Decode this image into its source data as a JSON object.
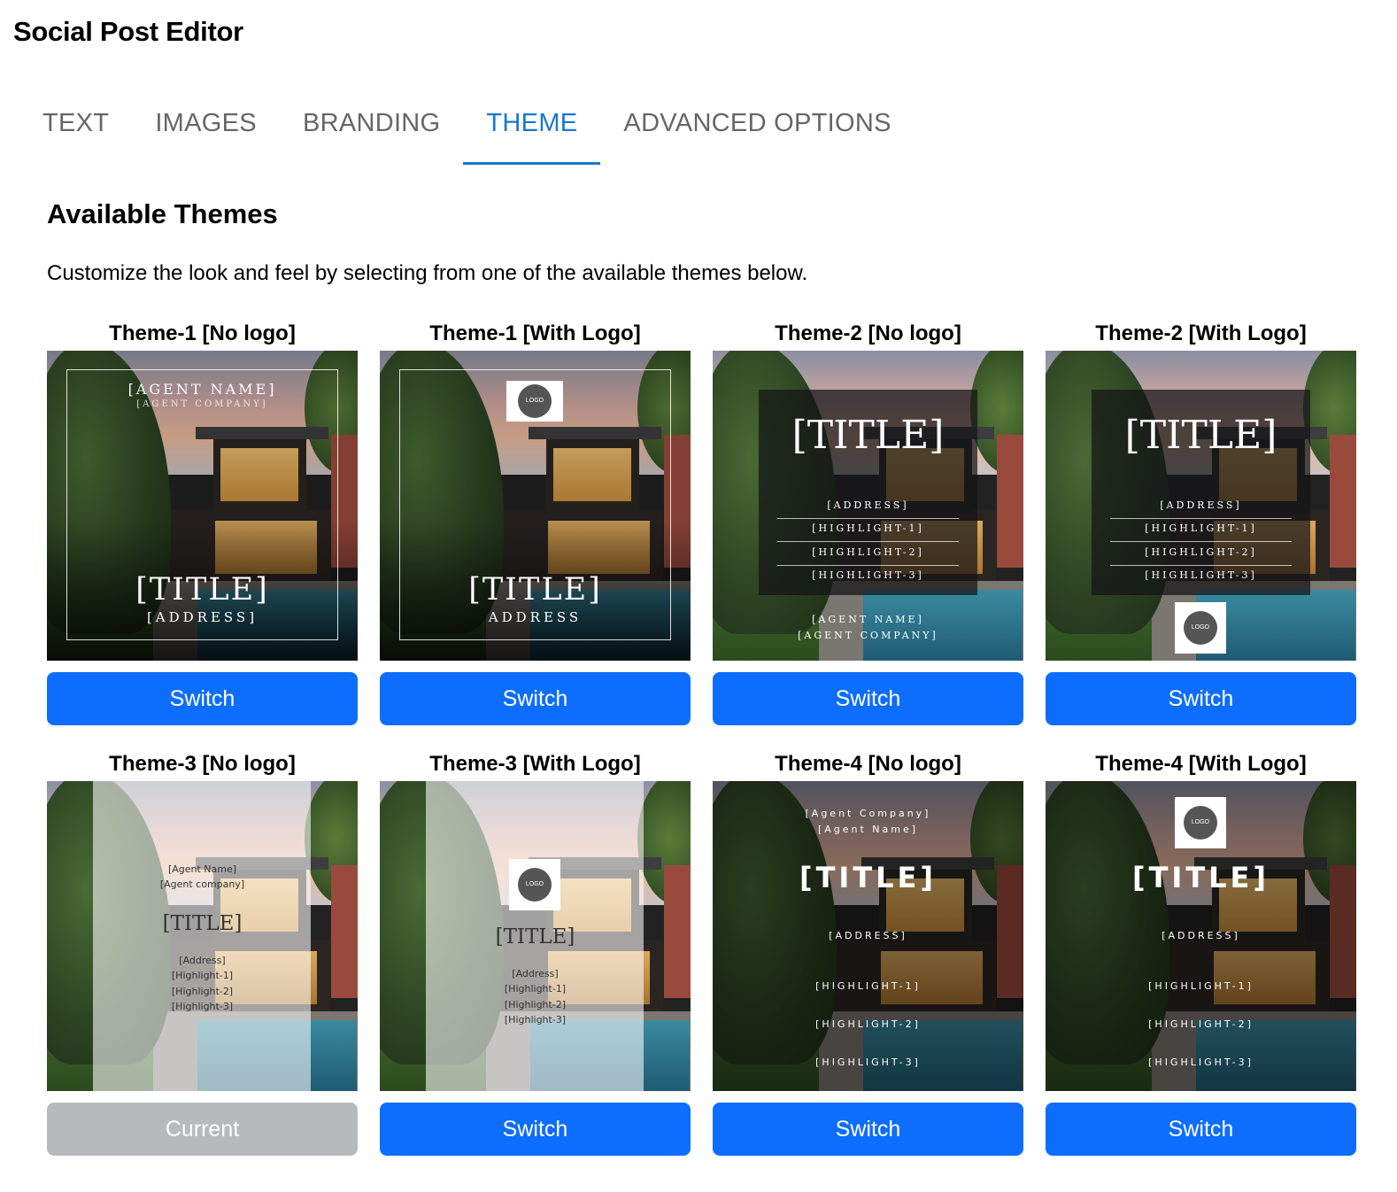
{
  "app": {
    "title": "Social Post Editor"
  },
  "tabs": [
    {
      "label": "TEXT",
      "active": false
    },
    {
      "label": "IMAGES",
      "active": false
    },
    {
      "label": "BRANDING",
      "active": false
    },
    {
      "label": "THEME",
      "active": true
    },
    {
      "label": "ADVANCED OPTIONS",
      "active": false
    }
  ],
  "colors": {
    "accent": "#1976d2",
    "button": "#0d6efd",
    "button_disabled": "#b7babc",
    "tab_inactive": "#666666"
  },
  "section": {
    "title": "Available Themes",
    "description": "Customize the look and feel by selecting from one of the available themes below."
  },
  "themes": [
    {
      "name": "Theme-1 [No logo]",
      "button": "Switch",
      "current": false,
      "preview": {
        "agent_name": "[AGENT NAME]",
        "agent_company": "[AGENT COMPANY]",
        "title": "[TITLE]",
        "address": "[ADDRESS]"
      }
    },
    {
      "name": "Theme-1 [With Logo]",
      "button": "Switch",
      "current": false,
      "preview": {
        "logo": "LOGO",
        "title": "[TITLE]",
        "address": "ADDRESS"
      }
    },
    {
      "name": "Theme-2 [No logo]",
      "button": "Switch",
      "current": false,
      "preview": {
        "title": "[TITLE]",
        "address": "[ADDRESS]",
        "highlight_1": "[HIGHLIGHT-1]",
        "highlight_2": "[HIGHLIGHT-2]",
        "highlight_3": "[HIGHLIGHT-3]",
        "agent_name": "[AGENT NAME]",
        "agent_company": "[AGENT COMPANY]"
      }
    },
    {
      "name": "Theme-2 [With Logo]",
      "button": "Switch",
      "current": false,
      "preview": {
        "title": "[TITLE]",
        "address": "[ADDRESS]",
        "highlight_1": "[HIGHLIGHT-1]",
        "highlight_2": "[HIGHLIGHT-2]",
        "highlight_3": "[HIGHLIGHT-3]",
        "logo": "LOGO"
      }
    },
    {
      "name": "Theme-3 [No logo]",
      "button": "Current",
      "current": true,
      "preview": {
        "agent_name": "[Agent Name]",
        "agent_company": "[Agent company]",
        "title": "[TITLE]",
        "address": "[Address]",
        "highlight_1": "[Highlight-1]",
        "highlight_2": "[Highlight-2]",
        "highlight_3": "[Highlight-3]"
      }
    },
    {
      "name": "Theme-3 [With Logo]",
      "button": "Switch",
      "current": false,
      "preview": {
        "logo": "LOGO",
        "title": "[TITLE]",
        "address": "[Address]",
        "highlight_1": "[Highlight-1]",
        "highlight_2": "[Highlight-2]",
        "highlight_3": "[Highlight-3]"
      }
    },
    {
      "name": "Theme-4 [No logo]",
      "button": "Switch",
      "current": false,
      "preview": {
        "agent_company": "[Agent Company]",
        "agent_name": "[Agent Name]",
        "title": "[TITLE]",
        "address": "[ADDRESS]",
        "highlight_1": "[HIGHLIGHT-1]",
        "highlight_2": "[HIGHLIGHT-2]",
        "highlight_3": "[HIGHLIGHT-3]"
      }
    },
    {
      "name": "Theme-4 [With Logo]",
      "button": "Switch",
      "current": false,
      "preview": {
        "logo": "LOGO",
        "title": "[TITLE]",
        "address": "[ADDRESS]",
        "highlight_1": "[HIGHLIGHT-1]",
        "highlight_2": "[HIGHLIGHT-2]",
        "highlight_3": "[HIGHLIGHT-3]"
      }
    }
  ]
}
